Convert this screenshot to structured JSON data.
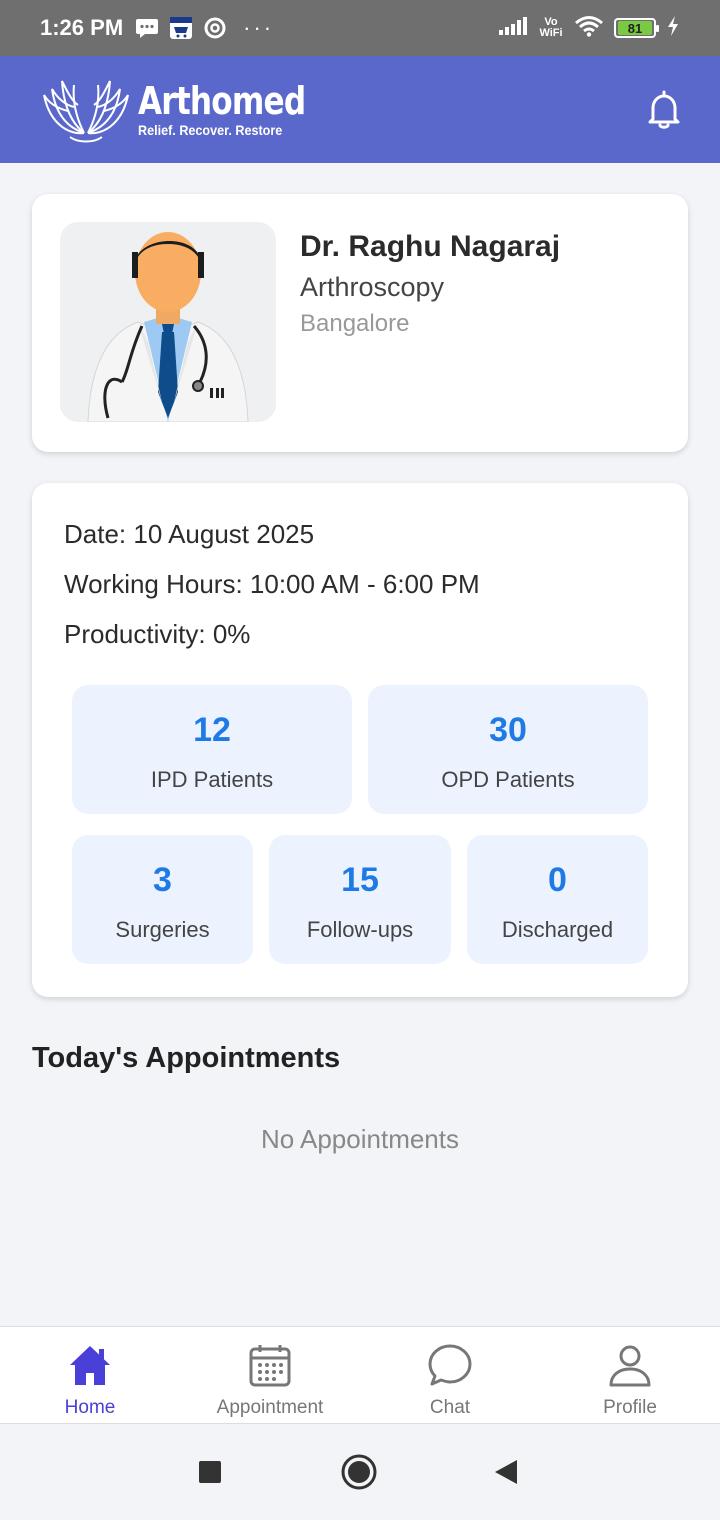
{
  "status_bar": {
    "time": "1:26 PM",
    "icons": [
      "message-icon",
      "amazon-icon",
      "at-icon",
      "signal-icon",
      "vowifi-icon",
      "wifi-icon",
      "charging-icon"
    ],
    "dots": "···",
    "battery": "81",
    "vowifi": "Vo WiFi"
  },
  "header": {
    "brand_name": "Arthomed",
    "brand_tagline": "Relief. Recover. Restore",
    "bg_color": "#5b68cb"
  },
  "doctor": {
    "name": "Dr. Raghu Nagaraj",
    "specialty": "Arthroscopy",
    "city": "Bangalore"
  },
  "summary": {
    "date": "Date: 10 August 2025",
    "working_hours": "Working Hours: 10:00 AM - 6:00 PM",
    "productivity": "Productivity: 0%"
  },
  "stats": {
    "ipd": {
      "value": "12",
      "label": "IPD Patients"
    },
    "opd": {
      "value": "30",
      "label": "OPD Patients"
    },
    "surgeries": {
      "value": "3",
      "label": "Surgeries"
    },
    "followups": {
      "value": "15",
      "label": "Follow-ups"
    },
    "discharged": {
      "value": "0",
      "label": "Discharged"
    },
    "accent_color": "#1e7be5"
  },
  "appointments": {
    "title": "Today's Appointments",
    "empty_message": "No Appointments"
  },
  "bottom_nav": {
    "items": [
      {
        "label": "Home",
        "icon": "home-icon",
        "active": true
      },
      {
        "label": "Appointment",
        "icon": "calendar-icon",
        "active": false
      },
      {
        "label": "Chat",
        "icon": "chat-icon",
        "active": false
      },
      {
        "label": "Profile",
        "icon": "profile-icon",
        "active": false
      }
    ],
    "active_color": "#4a3fd6"
  },
  "system_nav": {
    "icons": [
      "recent-apps-icon",
      "home-circle-icon",
      "back-icon"
    ]
  }
}
